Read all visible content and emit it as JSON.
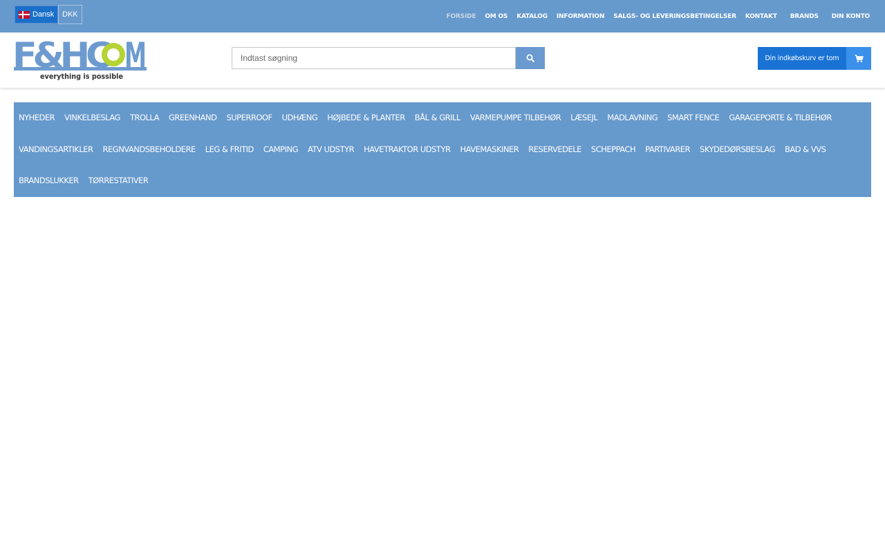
{
  "topbar": {
    "language_label": "Dansk",
    "currency_label": "DKK",
    "nav": [
      {
        "label": "FORSIDE",
        "active": true
      },
      {
        "label": "OM OS"
      },
      {
        "label": "KATALOG"
      },
      {
        "label": "INFORMATION"
      },
      {
        "label": "SALGS- OG LEVERINGSBETINGELSER"
      },
      {
        "label": "KONTAKT"
      },
      {
        "label": "BRANDS"
      },
      {
        "label": "DIN KONTO"
      }
    ]
  },
  "header": {
    "logo_text": "F&HCOM",
    "logo_tagline": "everything is possible",
    "search_placeholder": "Indtast søgning",
    "cart_label": "Din indkøbskurv er tom"
  },
  "categories": [
    "NYHEDER",
    "VINKELBESLAG",
    "TROLLA",
    "GREENHAND",
    "SUPERROOF",
    "UDHÆNG",
    "HØJBEDE & PLANTER",
    "BÅL & GRILL",
    "VARMEPUMPE TILBEHØR",
    "LÆSEJL",
    "MADLAVNING",
    "SMART FENCE",
    "GARAGEPORTE & TILBEHØR",
    "VANDINGSARTIKLER",
    "REGNVANDSBEHOLDERE",
    "LEG & FRITID",
    "CAMPING",
    "ATV UDSTYR",
    "HAVETRAKTOR UDSTYR",
    "HAVEMASKINER",
    "RESERVEDELE",
    "SCHEPPACH",
    "PARTIVARER",
    "SKYDEDØRSBESLAG",
    "BAD & VVS",
    "BRANDSLUKKER",
    "TØRRESTATIVER"
  ],
  "colors": {
    "topbar_bg": "#6699cc",
    "accent_blue": "#1a73d4",
    "logo_blue": "#6d9bcf",
    "logo_green": "#b5d334"
  },
  "icons": {
    "search": "search-icon",
    "cart": "cart-icon",
    "flag": "denmark-flag-icon"
  }
}
